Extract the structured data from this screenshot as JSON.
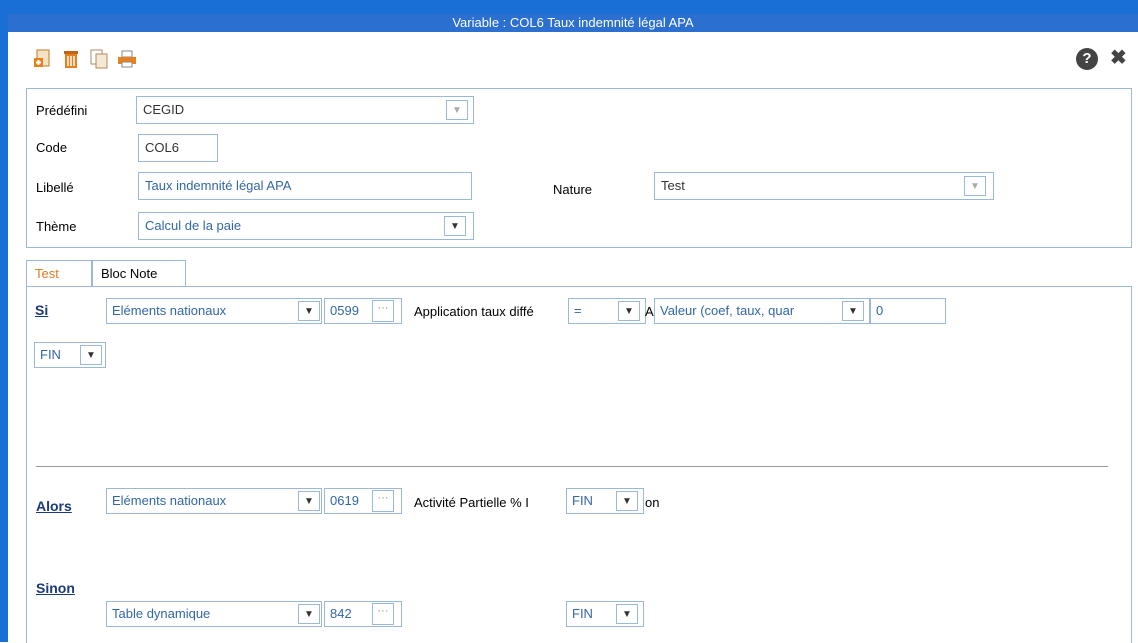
{
  "window": {
    "title": "Variable : COL6 Taux indemnité légal APA"
  },
  "toolbar": {
    "icons": [
      "new-doc-icon",
      "trash-icon",
      "copy-icon",
      "print-icon"
    ],
    "help": "?",
    "close": "✖"
  },
  "form": {
    "predefini_label": "Prédéfini",
    "predefini_value": "CEGID",
    "code_label": "Code",
    "code_value": "COL6",
    "libelle_label": "Libellé",
    "libelle_value": "Taux indemnité légal APA",
    "nature_label": "Nature",
    "nature_value": "Test",
    "theme_label": "Thème",
    "theme_value": "Calcul de la paie"
  },
  "tabs": [
    "Test",
    "Bloc Note"
  ],
  "test": {
    "si": {
      "label": "Si",
      "source": "Eléments nationaux",
      "code": "0599",
      "description": "Application taux diffé",
      "operator": "=",
      "a_label": "A",
      "value_type": "Valeur (coef, taux, quar",
      "value": "0",
      "fin": "FIN"
    },
    "alors": {
      "label": "Alors",
      "source": "Eléments nationaux",
      "code": "0619",
      "description": "Activité Partielle % I",
      "fin": "FIN",
      "suffix": "on"
    },
    "sinon": {
      "label": "Sinon",
      "source": "Table dynamique",
      "code": "842",
      "fin": "FIN"
    }
  },
  "colors": {
    "titlebar": "#2b6fd0",
    "accent_tab": "#e07a20",
    "field_text": "#3366a8"
  }
}
